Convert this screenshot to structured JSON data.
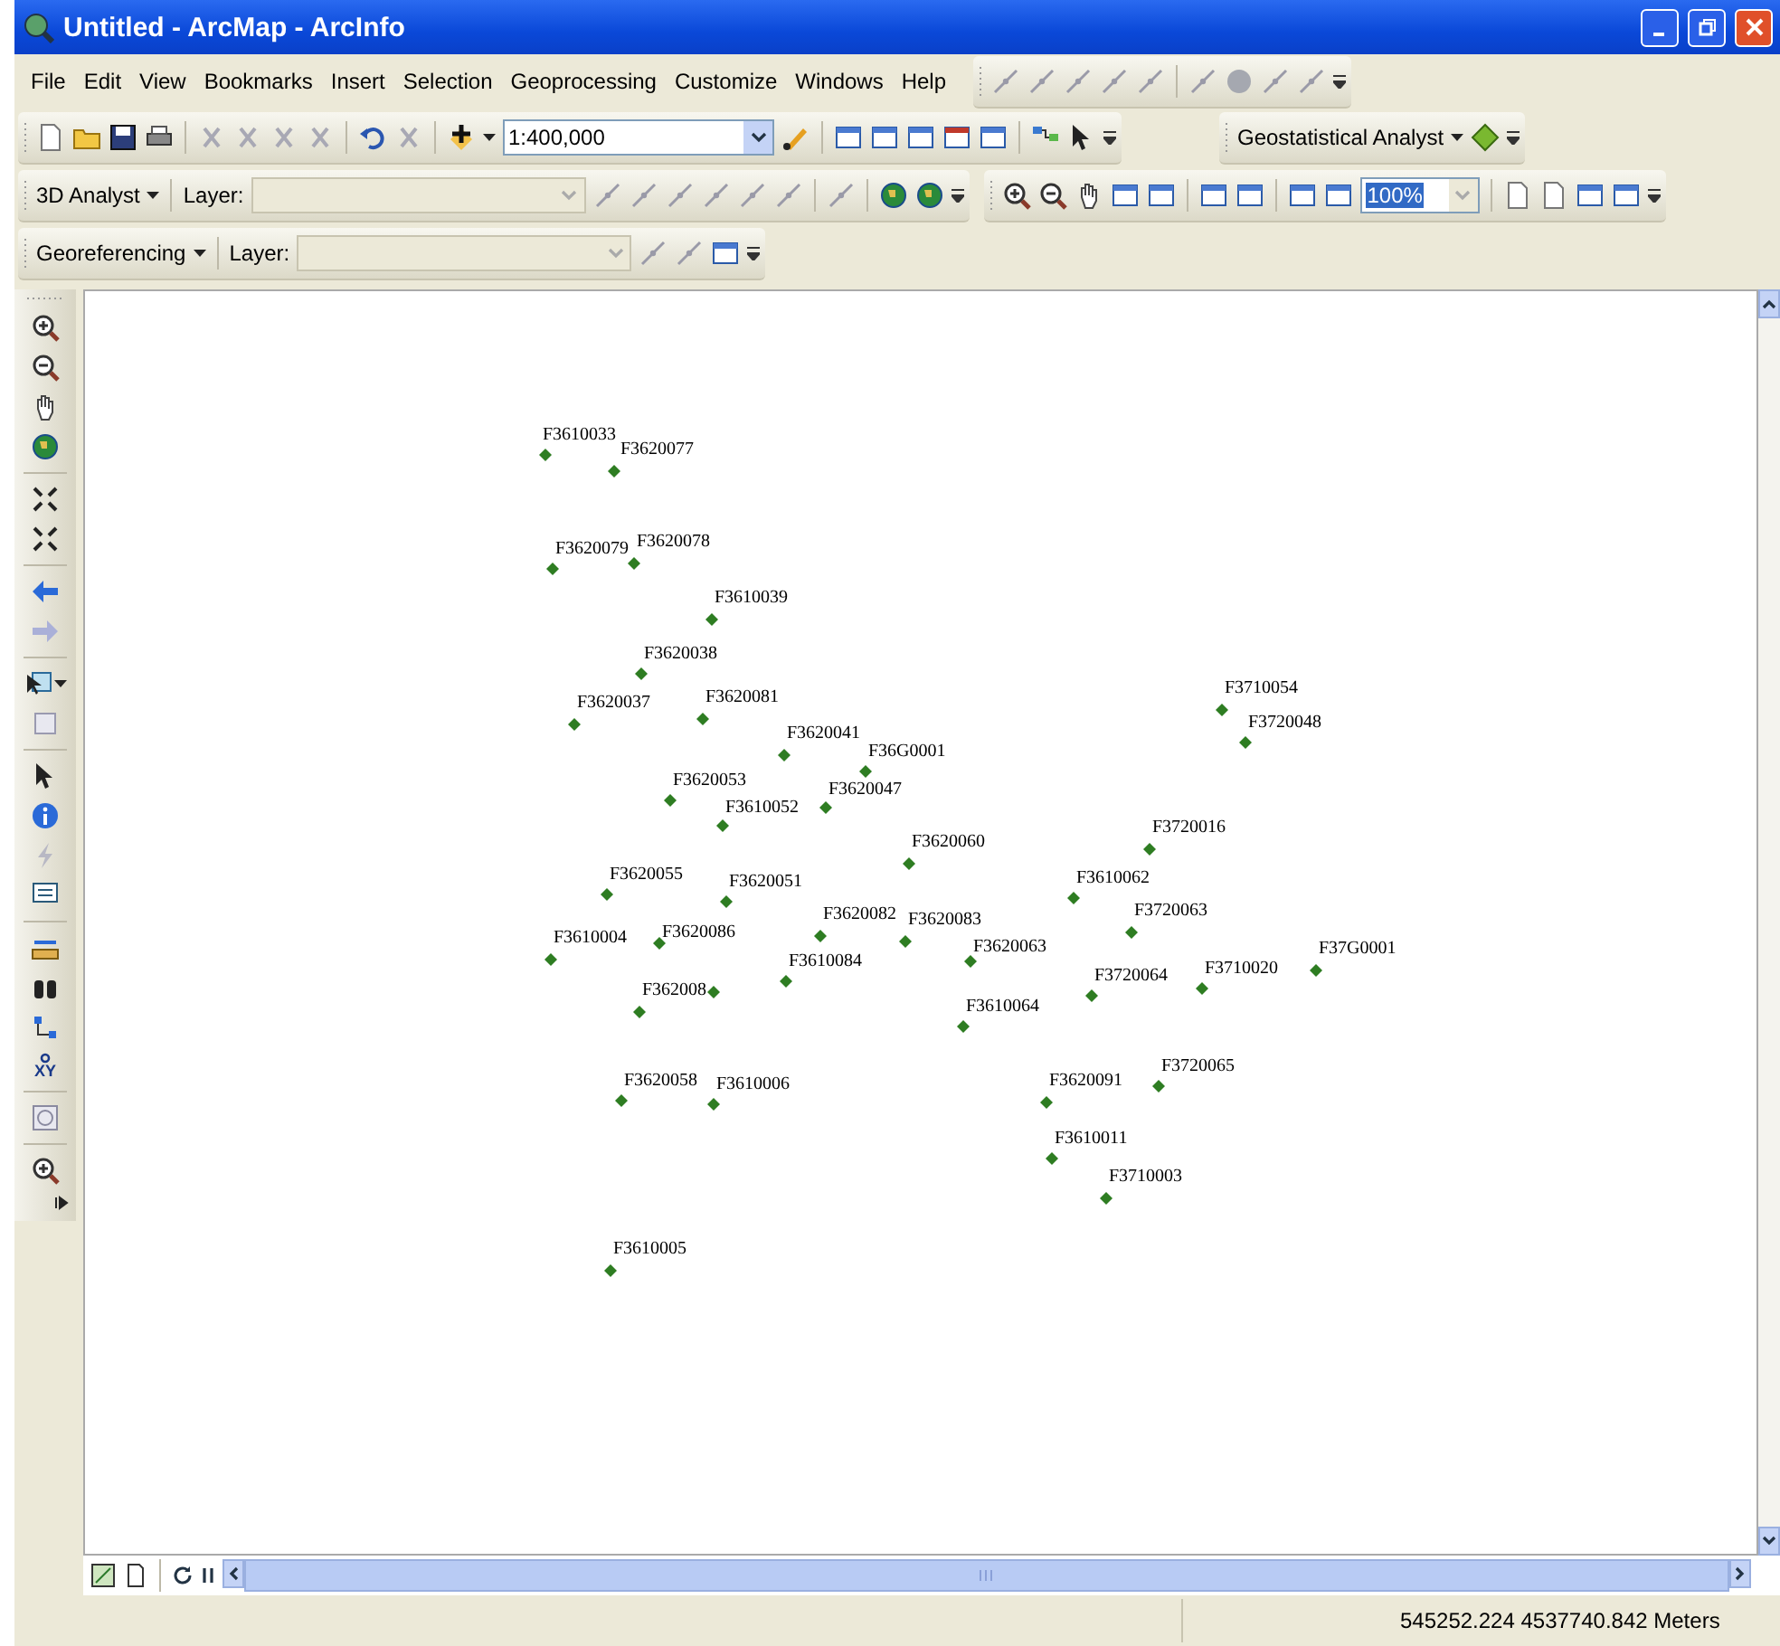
{
  "window": {
    "title": "Untitled - ArcMap - ArcInfo"
  },
  "menu": [
    "File",
    "Edit",
    "View",
    "Bookmarks",
    "Insert",
    "Selection",
    "Geoprocessing",
    "Customize",
    "Windows",
    "Help"
  ],
  "standard_toolbar": {
    "scale": "1:400,000"
  },
  "geostatistical_toolbar": {
    "label": "Geostatistical Analyst"
  },
  "analyst_3d_toolbar": {
    "label": "3D Analyst",
    "layer_label": "Layer:"
  },
  "layout_toolbar": {
    "zoom": "100%"
  },
  "georeferencing_toolbar": {
    "label": "Georeferencing",
    "layer_label": "Layer:"
  },
  "tools": {
    "xy_label": "XY"
  },
  "map": {
    "points": [
      {
        "label": "F3610033"
      },
      {
        "label": "F3620077"
      },
      {
        "label": "F3620079"
      },
      {
        "label": "F3620078"
      },
      {
        "label": "F3610039"
      },
      {
        "label": "F3620038"
      },
      {
        "label": "F3620037"
      },
      {
        "label": "F3620081"
      },
      {
        "label": "F3620041"
      },
      {
        "label": "F36G0001"
      },
      {
        "label": "F3620053"
      },
      {
        "label": "F3620047"
      },
      {
        "label": "F3610052"
      },
      {
        "label": "F3620060"
      },
      {
        "label": "F3620055"
      },
      {
        "label": "F3620051"
      },
      {
        "label": "F3620082"
      },
      {
        "label": "F3620083"
      },
      {
        "label": "F3610004"
      },
      {
        "label": "F3620086"
      },
      {
        "label": "F3610084"
      },
      {
        "label": "F3620063"
      },
      {
        "label": "F362008"
      },
      {
        "label": "F3620058"
      },
      {
        "label": "F3610006"
      },
      {
        "label": "F3610005"
      },
      {
        "label": "F3710054"
      },
      {
        "label": "F3720048"
      },
      {
        "label": "F3720016"
      },
      {
        "label": "F3610062"
      },
      {
        "label": "F3720063"
      },
      {
        "label": "F37G0001"
      },
      {
        "label": "F3720064"
      },
      {
        "label": "F3710020"
      },
      {
        "label": "F3610064"
      },
      {
        "label": "F3720065"
      },
      {
        "label": "F3620091"
      },
      {
        "label": "F3610011"
      },
      {
        "label": "F3710003"
      },
      {
        "kind": "unlabeled"
      }
    ]
  },
  "status_bar": {
    "coordinates": "545252.224  4537740.842 Meters"
  }
}
